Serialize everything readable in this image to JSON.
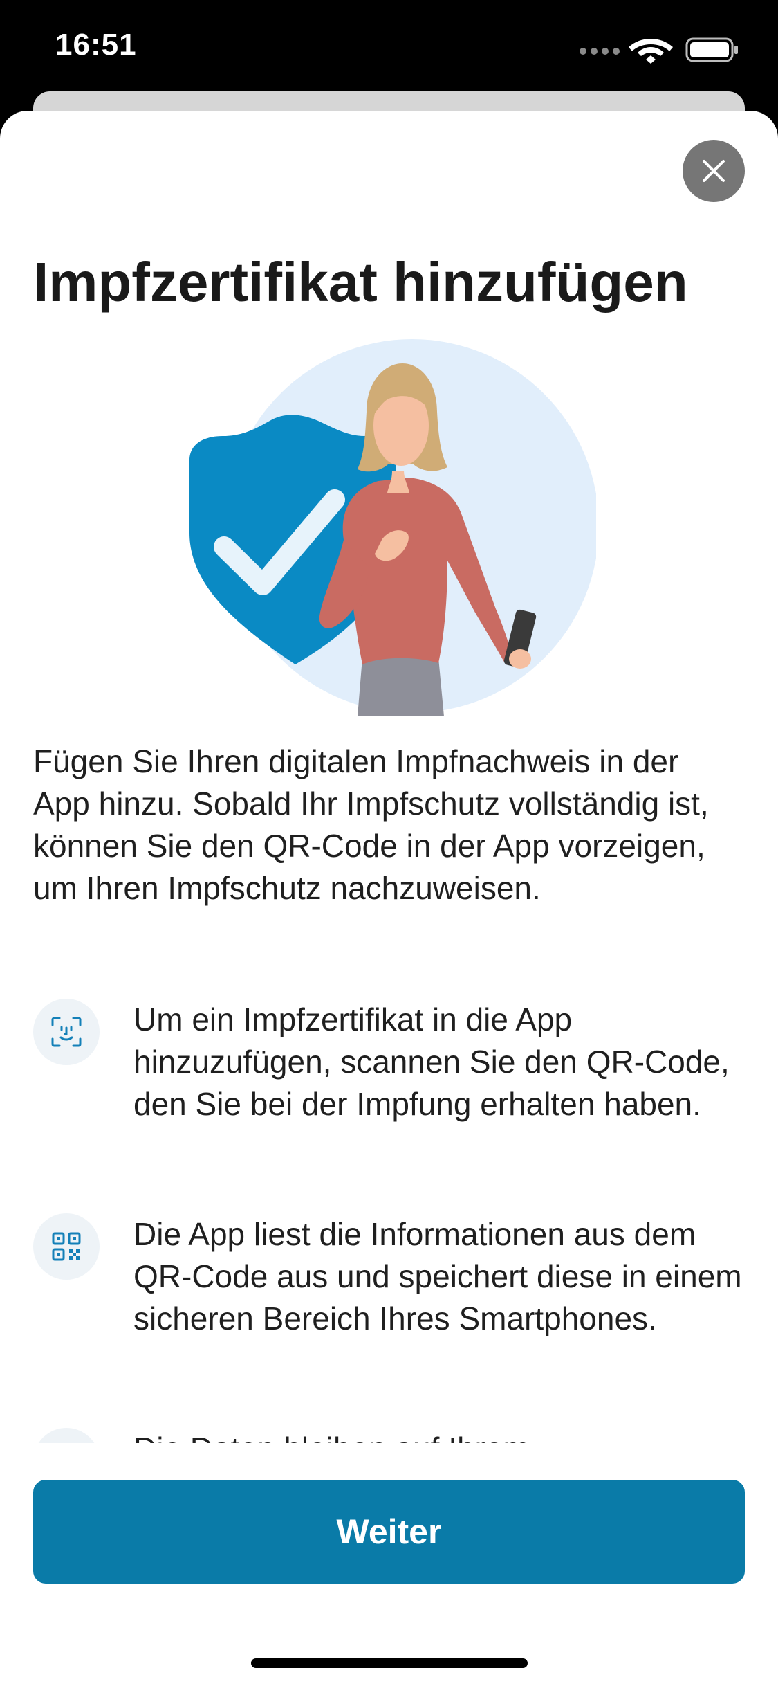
{
  "status_bar": {
    "time": "16:51",
    "icons": [
      "cellular-signal-icon",
      "wifi-icon",
      "battery-icon"
    ]
  },
  "sheet": {
    "close_icon": "close-icon",
    "title": "Impfzertifikat hinzufügen",
    "intro": "Fügen Sie Ihren digitalen Impfnachweis in der App hinzu. Sobald Ihr Impfschutz vollständig ist, können Sie den QR-Code in der App vorzeigen, um Ihren Impfschutz nachzuweisen.",
    "items": [
      {
        "icon": "face-scan-icon",
        "text": "Um ein Impfzertifikat in die App hinzuzufügen, scannen Sie den QR-Code, den Sie bei der Impfung erhalten haben."
      },
      {
        "icon": "qr-code-icon",
        "text": "Die App liest die Informationen aus dem QR-Code aus und speichert diese in einem sicheren Bereich Ihres Smartphones."
      },
      {
        "icon": "info-icon",
        "text": "Die Daten bleiben auf Ihrem"
      }
    ],
    "button_label": "Weiter"
  },
  "colors": {
    "accent": "#0a7ba8",
    "shield": "#0a8ac4",
    "close_bg": "#767676",
    "illustration_circle": "#e1eefb"
  }
}
